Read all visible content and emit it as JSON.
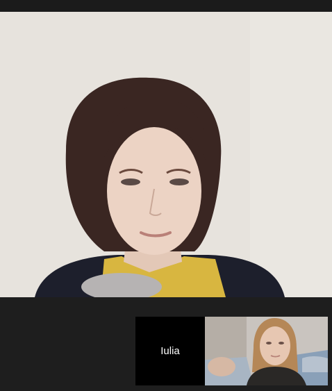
{
  "call": {
    "participant_tile": {
      "name": "Iulia"
    },
    "main_video": {
      "content": "remote-participant-camera-feed"
    },
    "self_view": {
      "content": "local-camera-preview"
    }
  },
  "colors": {
    "chrome_background": "#1e1e1e",
    "name_tile_background": "#000000",
    "name_text": "#ffffff"
  }
}
